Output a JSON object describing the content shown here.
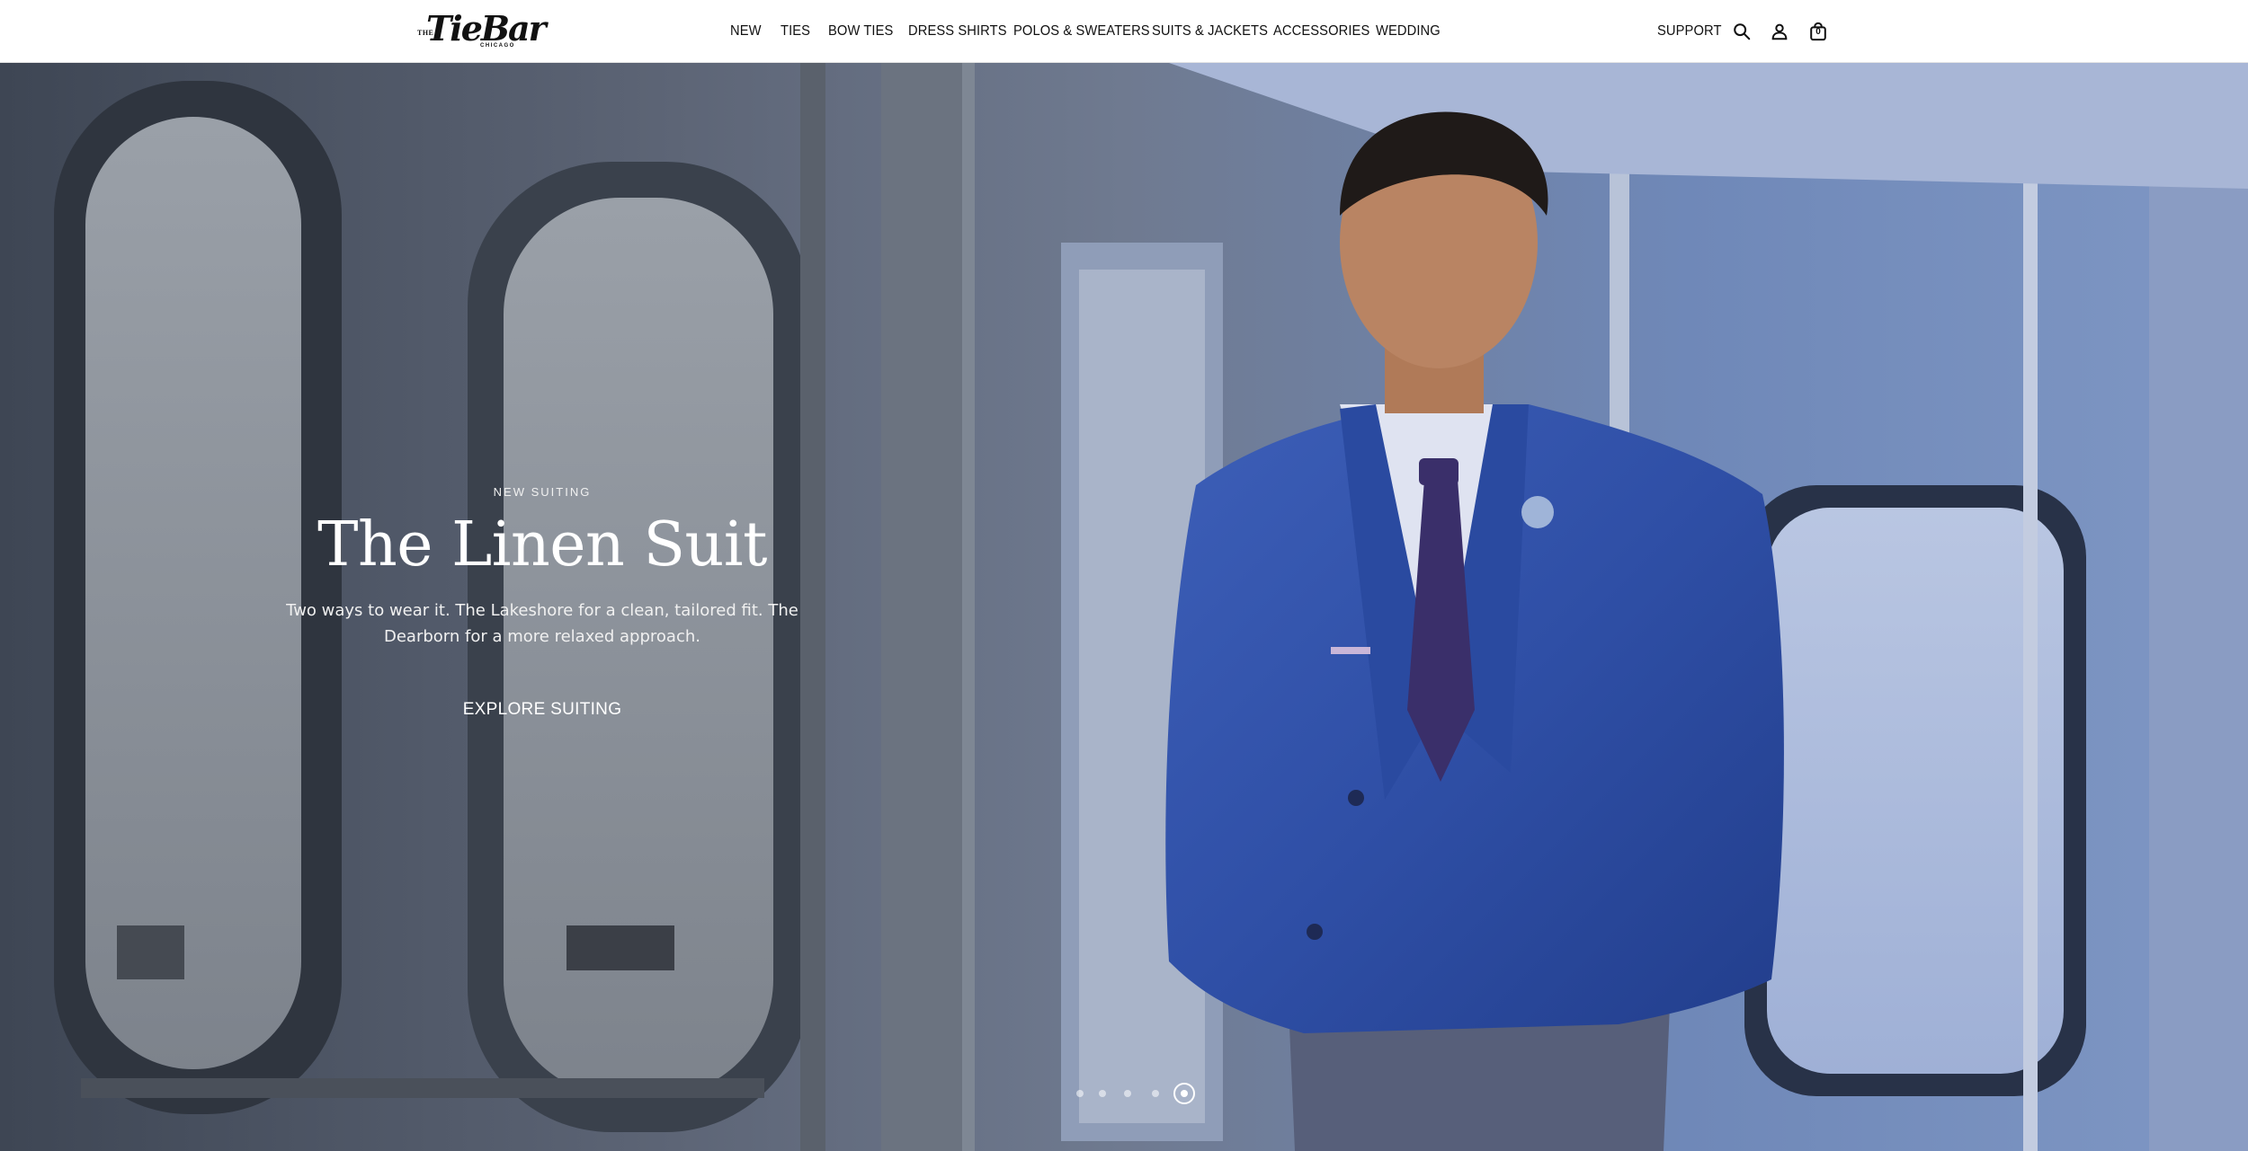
{
  "brand": {
    "logo_the": "THE",
    "logo_word": "TieBar",
    "logo_city": "CHICAGO"
  },
  "nav": {
    "items": [
      {
        "label": "NEW"
      },
      {
        "label": "TIES"
      },
      {
        "label": "BOW TIES"
      },
      {
        "label": "DRESS SHIRTS"
      },
      {
        "label": "POLOS & SWEATERS"
      },
      {
        "label": "SUITS & JACKETS"
      },
      {
        "label": "ACCESSORIES"
      },
      {
        "label": "WEDDING"
      }
    ],
    "support_label": "SUPPORT",
    "icons": {
      "search": "search-icon",
      "account": "account-icon",
      "cart": "shopping-bag-icon"
    },
    "cart_count": "0"
  },
  "hero": {
    "eyebrow": "NEW SUITING",
    "headline": "The Linen Suit",
    "subcopy": "Two ways to wear it. The Lakeshore for a clean, tailored fit. The Dearborn for a more relaxed approach.",
    "cta_label": "EXPLORE SUITING",
    "slides": {
      "count": 5,
      "active_index": 5
    }
  },
  "colors": {
    "header_bg": "#ffffff",
    "text_dark": "#111111",
    "hero_text": "#ffffff",
    "jacket_blue": "#2f4fa6"
  }
}
